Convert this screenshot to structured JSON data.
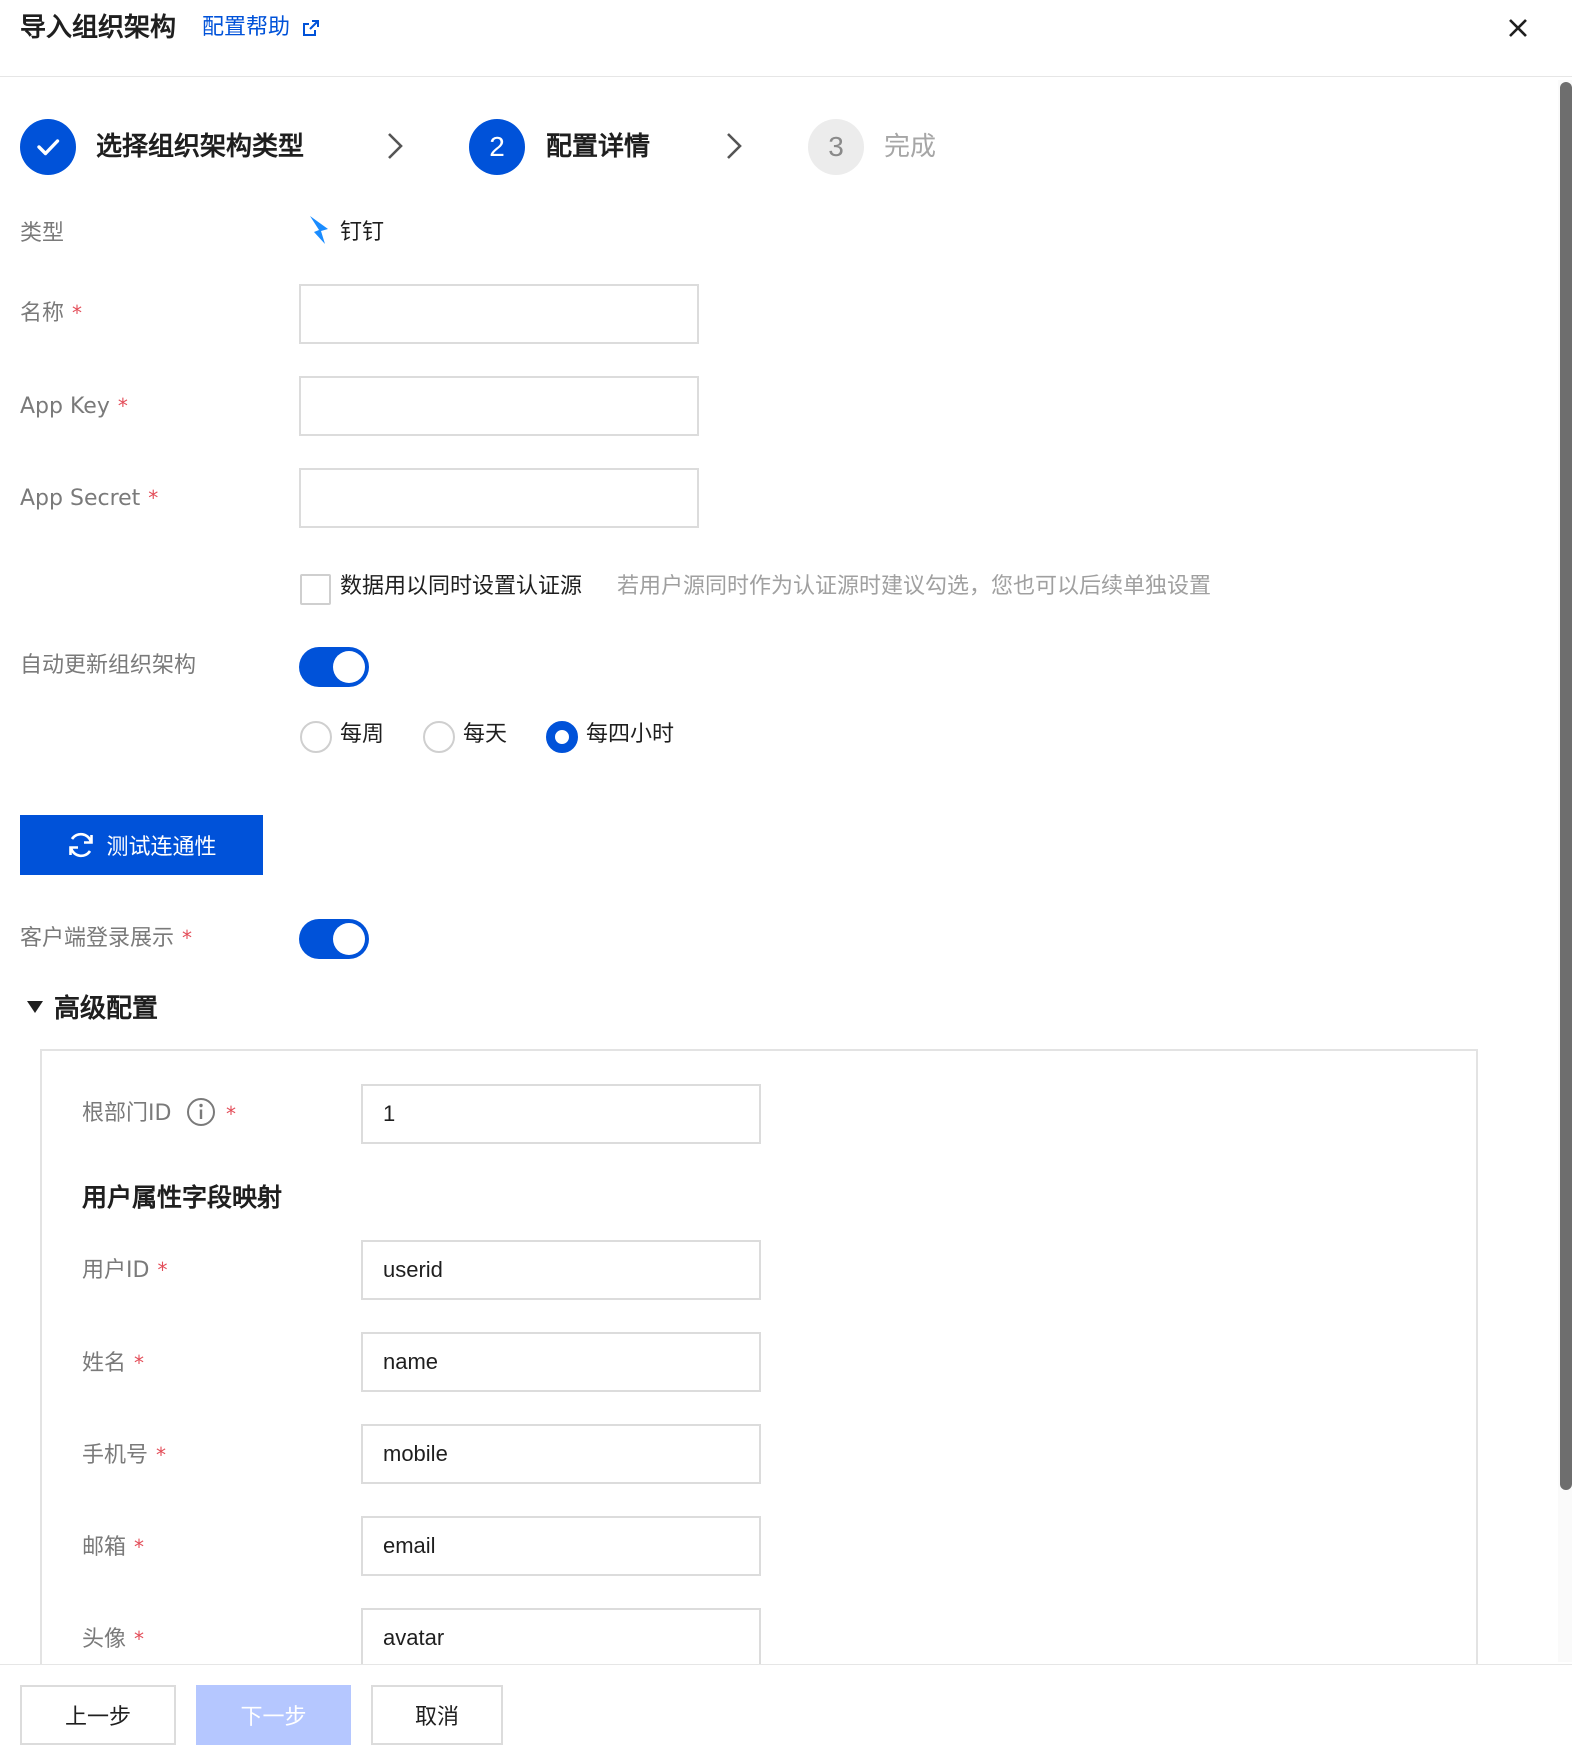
{
  "header": {
    "title": "导入组织架构",
    "help_link": "配置帮助"
  },
  "steps": [
    {
      "label": "选择组织架构类型",
      "state": "done"
    },
    {
      "label": "配置详情",
      "number": "2",
      "state": "active"
    },
    {
      "label": "完成",
      "number": "3",
      "state": "todo"
    }
  ],
  "form": {
    "type_label": "类型",
    "type_value": "钉钉",
    "name_label": "名称",
    "name_value": "",
    "app_key_label": "App Key",
    "app_key_value": "",
    "app_secret_label": "App Secret",
    "app_secret_value": "",
    "required_mark": "*",
    "auth_checkbox_label": "数据用以同时设置认证源",
    "auth_checkbox_hint": "若用户源同时作为认证源时建议勾选，您也可以后续单独设置",
    "auth_checkbox_checked": false,
    "auto_update_label": "自动更新组织架构",
    "auto_update_on": true,
    "frequency_options": [
      "每周",
      "每天",
      "每四小时"
    ],
    "frequency_selected": "每四小时",
    "test_button": "测试连通性",
    "client_login_label": "客户端登录展示",
    "client_login_on": true
  },
  "advanced": {
    "section_title": "高级配置",
    "root_dept_label": "根部门ID",
    "root_dept_value": "1",
    "mapping_title": "用户属性字段映射",
    "fields": [
      {
        "label": "用户ID",
        "value": "userid"
      },
      {
        "label": "姓名",
        "value": "name"
      },
      {
        "label": "手机号",
        "value": "mobile"
      },
      {
        "label": "邮箱",
        "value": "email"
      },
      {
        "label": "头像",
        "value": "avatar"
      }
    ]
  },
  "footer": {
    "prev_button": "上一步",
    "next_button": "下一步",
    "cancel_button": "取消"
  },
  "colors": {
    "primary": "#0052d9",
    "required": "#e34d59",
    "disabled_button": "#b5c7ff",
    "dingtalk_brand": "#1a8cff"
  },
  "icons": {
    "close": "close-icon",
    "external_link": "external-link-icon",
    "step_done": "check-icon",
    "step_separator": "chevron-right-icon",
    "type": "dingtalk-logo-icon",
    "test": "refresh-icon",
    "collapse": "caret-down-icon",
    "info": "info-icon"
  }
}
